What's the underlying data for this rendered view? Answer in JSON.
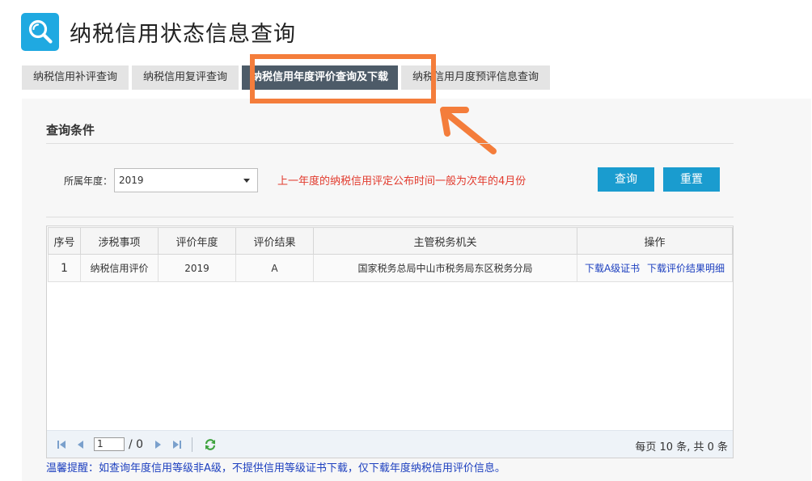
{
  "header": {
    "title": "纳税信用状态信息查询",
    "logo_icon": "search-icon"
  },
  "tabs": [
    {
      "label": "纳税信用补评查询",
      "active": false
    },
    {
      "label": "纳税信用复评查询",
      "active": false
    },
    {
      "label": "纳税信用年度评价查询及下载",
      "active": true
    },
    {
      "label": "纳税信用月度预评信息查询",
      "active": false
    }
  ],
  "query": {
    "section_title": "查询条件",
    "year_label": "所属年度：",
    "year_value": "2019",
    "notice": "上一年度的纳税信用评定公布时间一般为次年的4月份",
    "search_label": "查询",
    "reset_label": "重置"
  },
  "table": {
    "headers": [
      "序号",
      "涉税事项",
      "评价年度",
      "评价结果",
      "主管税务机关",
      "操作"
    ],
    "rows": [
      {
        "seq": "1",
        "item": "纳税信用评价",
        "year": "2019",
        "result": "A",
        "authority": "国家税务总局中山市税务局东区税务分局",
        "action1": "下载A级证书",
        "action2": "下载评价结果明细"
      }
    ]
  },
  "pager": {
    "page": "1",
    "total": "/ 0",
    "info": "每页 10 条, 共 0 条"
  },
  "tip": "温馨提醒：如查询年度信用等级非A级，不提供信用等级证书下载，仅下载年度纳税信用评价信息。",
  "colors": {
    "accent": "#1a9ccf",
    "active_tab": "#4d5b68",
    "highlight": "#f47d3b",
    "notice": "#e23b2e",
    "link": "#1c3fbf"
  }
}
